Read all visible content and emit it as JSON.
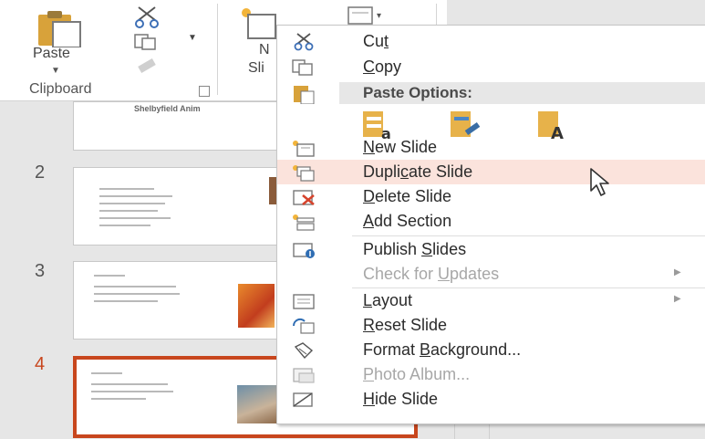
{
  "ribbon": {
    "paste_label": "Paste",
    "group_label": "Clipboard",
    "new_slide_partial": "N",
    "new_slide_partial2": "Sli"
  },
  "thumbnails": {
    "slide1_title": "Shelbyfield Anim",
    "slide2_number": "2",
    "slide3_number": "3",
    "slide4_number": "4"
  },
  "context_menu": {
    "cut": {
      "pre": "Cu",
      "u": "t",
      "post": ""
    },
    "copy": {
      "pre": "",
      "u": "C",
      "post": "opy"
    },
    "paste_options": "Paste Options:",
    "new_slide": {
      "pre": "",
      "u": "N",
      "post": "ew Slide"
    },
    "duplicate_slide": {
      "pre": "Dupli",
      "u": "c",
      "post": "ate Slide"
    },
    "delete_slide": {
      "pre": "",
      "u": "D",
      "post": "elete Slide"
    },
    "add_section": {
      "pre": "",
      "u": "A",
      "post": "dd Section"
    },
    "publish_slides": {
      "pre": "Publish ",
      "u": "S",
      "post": "lides"
    },
    "check_for_updates": {
      "pre": "Check for ",
      "u": "U",
      "post": "pdates"
    },
    "layout": {
      "pre": "",
      "u": "L",
      "post": "ayout"
    },
    "reset_slide": {
      "pre": "",
      "u": "R",
      "post": "eset Slide"
    },
    "format_background": {
      "pre": "Format ",
      "u": "B",
      "post": "ackground..."
    },
    "photo_album": {
      "pre": "",
      "u": "P",
      "post": "hoto Album..."
    },
    "hide_slide": {
      "pre": "",
      "u": "H",
      "post": "ide Slide"
    }
  },
  "colors": {
    "accent": "#c8461d",
    "hover_bg": "#fbe3dc"
  }
}
